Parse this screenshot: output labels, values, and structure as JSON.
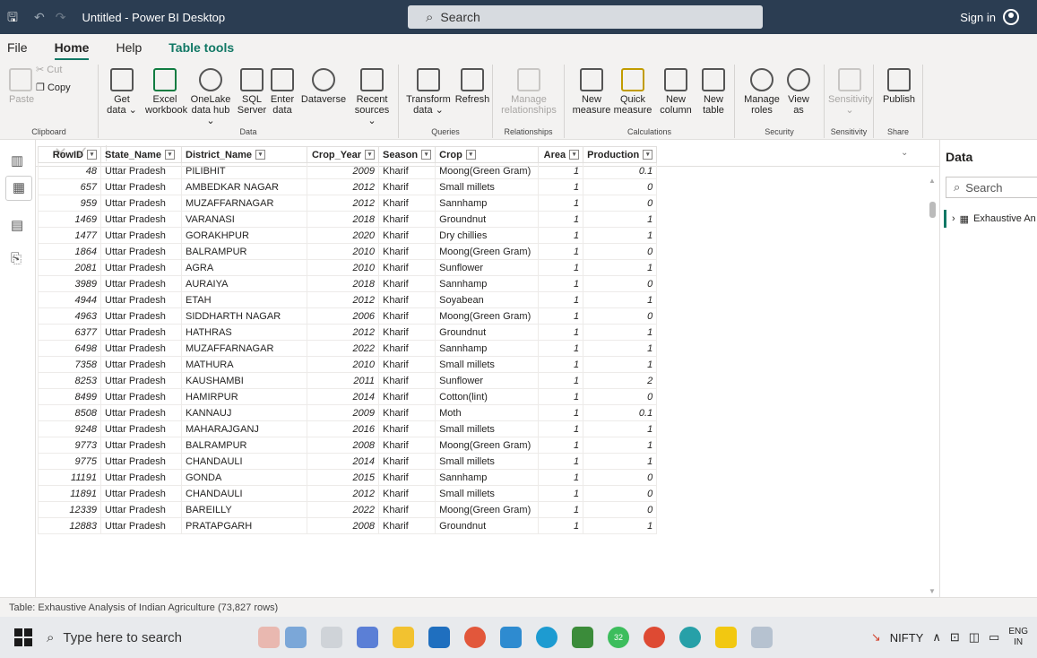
{
  "window": {
    "title": "Untitled - Power BI Desktop",
    "search_placeholder": "Search",
    "sign_in": "Sign in"
  },
  "menu": {
    "file": "File",
    "home": "Home",
    "help": "Help",
    "table_tools": "Table tools"
  },
  "ribbon": {
    "clipboard": {
      "label": "Clipboard",
      "paste": "Paste",
      "cut": "Cut",
      "copy": "Copy"
    },
    "data": {
      "label": "Data",
      "get_data_1": "Get",
      "get_data_2": "data ⌄",
      "excel_1": "Excel",
      "excel_2": "workbook",
      "onelake_1": "OneLake",
      "onelake_2": "data hub ⌄",
      "sql_1": "SQL",
      "sql_2": "Server",
      "enter_1": "Enter",
      "enter_2": "data",
      "dataverse": "Dataverse",
      "recent_1": "Recent",
      "recent_2": "sources ⌄"
    },
    "queries": {
      "label": "Queries",
      "transform_1": "Transform",
      "transform_2": "data ⌄",
      "refresh": "Refresh"
    },
    "relationships": {
      "label": "Relationships",
      "manage_1": "Manage",
      "manage_2": "relationships"
    },
    "calculations": {
      "label": "Calculations",
      "new_measure_1": "New",
      "new_measure_2": "measure",
      "quick_1": "Quick",
      "quick_2": "measure",
      "new_col_1": "New",
      "new_col_2": "column",
      "new_table_1": "New",
      "new_table_2": "table"
    },
    "security": {
      "label": "Security",
      "manage_roles_1": "Manage",
      "manage_roles_2": "roles",
      "view_as_1": "View",
      "view_as_2": "as"
    },
    "sensitivity": {
      "label": "Sensitivity",
      "btn": "Sensitivity",
      "btn_2": "⌄"
    },
    "share": {
      "label": "Share",
      "publish": "Publish"
    }
  },
  "table": {
    "columns": [
      "RowID",
      "State_Name",
      "District_Name",
      "Crop_Year",
      "Season",
      "Crop",
      "Area",
      "Production"
    ],
    "rows": [
      [
        "48",
        "Uttar Pradesh",
        "PILIBHIT",
        "2009",
        "Kharif",
        "Moong(Green Gram)",
        "1",
        "0.1"
      ],
      [
        "657",
        "Uttar Pradesh",
        "AMBEDKAR NAGAR",
        "2012",
        "Kharif",
        "Small millets",
        "1",
        "0"
      ],
      [
        "959",
        "Uttar Pradesh",
        "MUZAFFARNAGAR",
        "2012",
        "Kharif",
        "Sannhamp",
        "1",
        "0"
      ],
      [
        "1469",
        "Uttar Pradesh",
        "VARANASI",
        "2018",
        "Kharif",
        "Groundnut",
        "1",
        "1"
      ],
      [
        "1477",
        "Uttar Pradesh",
        "GORAKHPUR",
        "2020",
        "Kharif",
        "Dry chillies",
        "1",
        "1"
      ],
      [
        "1864",
        "Uttar Pradesh",
        "BALRAMPUR",
        "2010",
        "Kharif",
        "Moong(Green Gram)",
        "1",
        "0"
      ],
      [
        "2081",
        "Uttar Pradesh",
        "AGRA",
        "2010",
        "Kharif",
        "Sunflower",
        "1",
        "1"
      ],
      [
        "3989",
        "Uttar Pradesh",
        "AURAIYA",
        "2018",
        "Kharif",
        "Sannhamp",
        "1",
        "0"
      ],
      [
        "4944",
        "Uttar Pradesh",
        "ETAH",
        "2012",
        "Kharif",
        "Soyabean",
        "1",
        "1"
      ],
      [
        "4963",
        "Uttar Pradesh",
        "SIDDHARTH NAGAR",
        "2006",
        "Kharif",
        "Moong(Green Gram)",
        "1",
        "0"
      ],
      [
        "6377",
        "Uttar Pradesh",
        "HATHRAS",
        "2012",
        "Kharif",
        "Groundnut",
        "1",
        "1"
      ],
      [
        "6498",
        "Uttar Pradesh",
        "MUZAFFARNAGAR",
        "2022",
        "Kharif",
        "Sannhamp",
        "1",
        "1"
      ],
      [
        "7358",
        "Uttar Pradesh",
        "MATHURA",
        "2010",
        "Kharif",
        "Small millets",
        "1",
        "1"
      ],
      [
        "8253",
        "Uttar Pradesh",
        "KAUSHAMBI",
        "2011",
        "Kharif",
        "Sunflower",
        "1",
        "2"
      ],
      [
        "8499",
        "Uttar Pradesh",
        "HAMIRPUR",
        "2014",
        "Kharif",
        "Cotton(lint)",
        "1",
        "0"
      ],
      [
        "8508",
        "Uttar Pradesh",
        "KANNAUJ",
        "2009",
        "Kharif",
        "Moth",
        "1",
        "0.1"
      ],
      [
        "9248",
        "Uttar Pradesh",
        "MAHARAJGANJ",
        "2016",
        "Kharif",
        "Small millets",
        "1",
        "1"
      ],
      [
        "9773",
        "Uttar Pradesh",
        "BALRAMPUR",
        "2008",
        "Kharif",
        "Moong(Green Gram)",
        "1",
        "1"
      ],
      [
        "9775",
        "Uttar Pradesh",
        "CHANDAULI",
        "2014",
        "Kharif",
        "Small millets",
        "1",
        "1"
      ],
      [
        "11191",
        "Uttar Pradesh",
        "GONDA",
        "2015",
        "Kharif",
        "Sannhamp",
        "1",
        "0"
      ],
      [
        "11891",
        "Uttar Pradesh",
        "CHANDAULI",
        "2012",
        "Kharif",
        "Small millets",
        "1",
        "0"
      ],
      [
        "12339",
        "Uttar Pradesh",
        "BAREILLY",
        "2022",
        "Kharif",
        "Moong(Green Gram)",
        "1",
        "0"
      ],
      [
        "12883",
        "Uttar Pradesh",
        "PRATAPGARH",
        "2008",
        "Kharif",
        "Groundnut",
        "1",
        "1"
      ]
    ]
  },
  "data_pane": {
    "title": "Data",
    "search_placeholder": "Search",
    "table_item": "Exhaustive An"
  },
  "status": "Table: Exhaustive Analysis of Indian Agriculture (73,827 rows)",
  "taskbar": {
    "search_placeholder": "Type here to search",
    "nifty": "NIFTY",
    "lang_1": "ENG",
    "lang_2": "IN",
    "badge": "32"
  },
  "colors": {
    "accent": "#117865",
    "titlebar": "#2b3d52"
  }
}
